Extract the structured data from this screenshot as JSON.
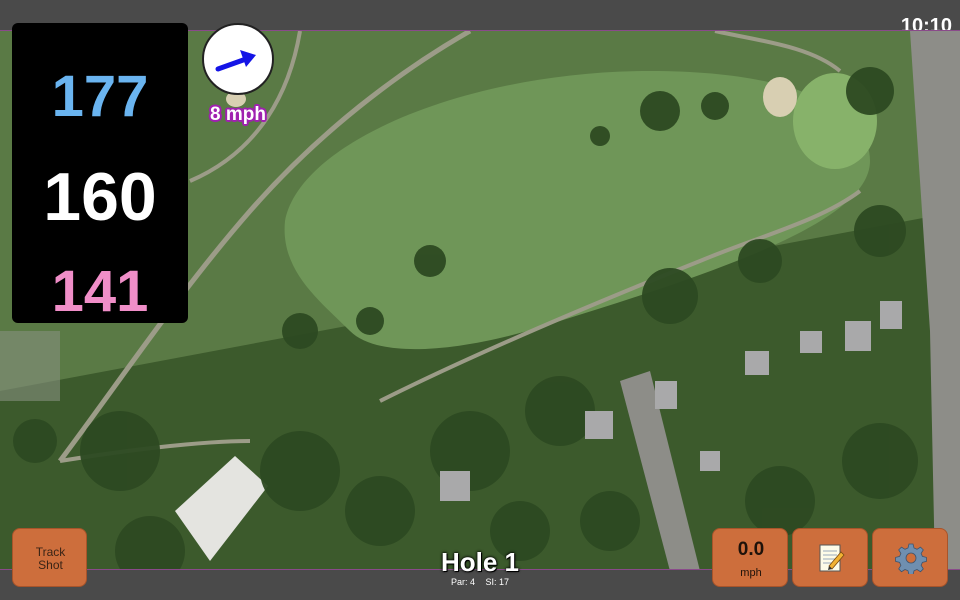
{
  "status": {
    "time": "10:10"
  },
  "distances": {
    "back": "177",
    "middle": "160",
    "front": "141"
  },
  "wind": {
    "speed_label": "8 mph",
    "arrow_icon": "wind-direction-arrow",
    "arrow_color": "#1414e6"
  },
  "track_shot": {
    "label": "Track\nShot"
  },
  "speed": {
    "value": "0.0",
    "unit": "mph"
  },
  "notes": {
    "icon": "notepad-pencil-icon"
  },
  "settings": {
    "icon": "gear-icon"
  },
  "hole": {
    "title": "Hole 1",
    "par": "Par: 4",
    "si": "SI: 17"
  },
  "colors": {
    "back": "#6ab4f0",
    "middle": "#ffffff",
    "front": "#f08ec8",
    "button": "#cd6e3c",
    "wind_text_outline": "#a020b0"
  }
}
